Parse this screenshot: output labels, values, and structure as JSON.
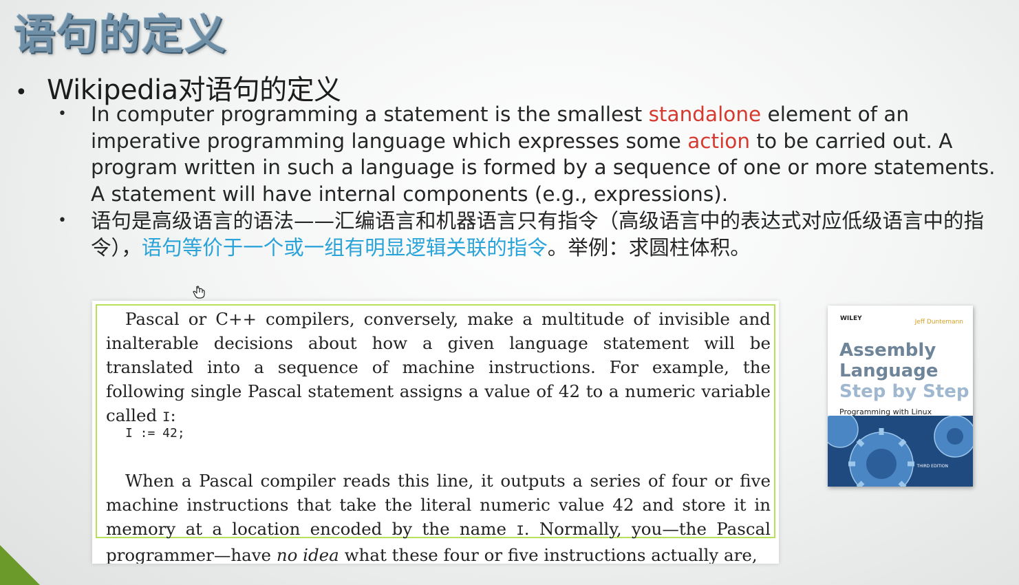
{
  "slide": {
    "title": "语句的定义",
    "bullet1": "Wikipedia对语句的定义",
    "sub1": {
      "p1": "In computer programming a statement is the smallest ",
      "hl1": "standalone",
      "p2": " element of an imperative programming language which expresses some ",
      "hl2": "action",
      "p3": " to be carried out. A program written in such a language is formed by a sequence of one or more statements. A statement will have internal components (e.g., expressions)."
    },
    "sub2": {
      "p1": "语句是高级语言的语法——汇编语言和机器语言只有指令（高级语言中的表达式对应低级语言中的指令），",
      "hl": "语句等价于一个或一组有明显逻辑关联的指令",
      "p2": "。举例：求圆柱体积。"
    }
  },
  "excerpt": {
    "para1": "Pascal or C++ compilers, conversely, make a multitude of invisible and inalterable decisions about how a given language statement will be translated into a sequence of machine instructions. For example, the following single Pascal statement assigns a value of 42 to a numeric variable called ",
    "var1": "I",
    "para1_end": ":",
    "code": "I := 42;",
    "para2a": "When a Pascal compiler reads this line, it outputs a series of four or five machine instructions that take the literal numeric value 42 and store it in memory at a location encoded by the name ",
    "var2": "I",
    "para2b": ". Normally, you—the Pascal programmer—have ",
    "em": "no idea",
    "para2c": " what these four or five instructions actually are,"
  },
  "book": {
    "publisher": "WILEY",
    "author": "Jeff Duntemann",
    "title_line1": "Assembly",
    "title_line2": "Language",
    "title_line3": "Step by Step",
    "subtitle": "Programming with Linux",
    "edition": "THIRD EDITION"
  },
  "colors": {
    "highlight_red": "#d63a2e",
    "highlight_blue": "#2aa3d8",
    "excerpt_border": "#b8e05a",
    "corner": "#6b9a2a",
    "title": "#6f8fa6"
  },
  "icons": [
    "hand-cursor-icon",
    "gear-icon"
  ]
}
